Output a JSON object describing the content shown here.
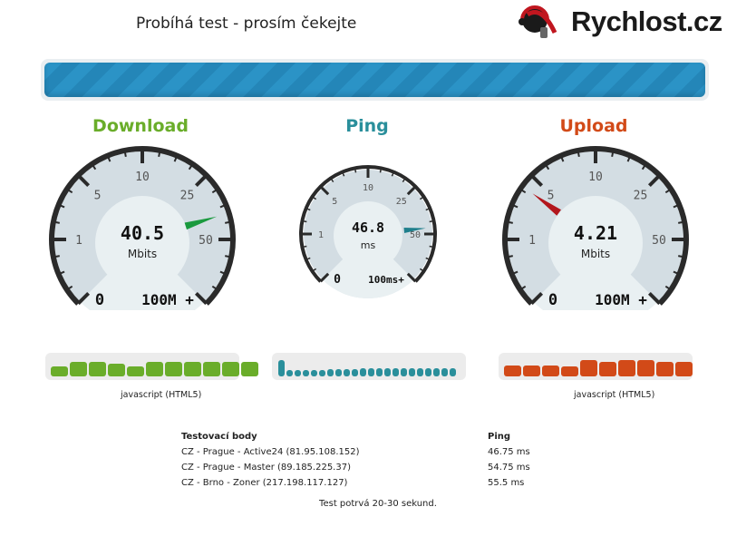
{
  "status_text": "Probíhá test - prosím čekejte",
  "logo_text": "Rychlost.cz",
  "progress_fraction": 1.0,
  "colors": {
    "download": "#6aad2a",
    "ping": "#2a8f9b",
    "upload": "#d24a18",
    "progress": "#2b93c6",
    "needle_download": "#1a9a3e",
    "needle_ping": "#1f7f8c",
    "needle_upload": "#b3161c"
  },
  "download": {
    "title": "Download",
    "value": "40.5",
    "unit": "Mbits",
    "min_label": "0",
    "max_label": "100M +",
    "ticks": [
      "1",
      "5",
      "10",
      "25",
      "50"
    ],
    "needle_value": 40.5,
    "history": [
      0.55,
      0.8,
      0.8,
      0.7,
      0.55,
      0.8,
      0.8,
      0.8,
      0.8,
      0.8,
      0.8
    ],
    "engine": "javascript (HTML5)"
  },
  "ping": {
    "title": "Ping",
    "value": "46.8",
    "unit": "ms",
    "min_label": "0",
    "max_label": "100ms+",
    "ticks": [
      "1",
      "5",
      "10",
      "25",
      "50"
    ],
    "needle_value": 46.8,
    "history": [
      0.9,
      0.35,
      0.35,
      0.35,
      0.35,
      0.35,
      0.4,
      0.4,
      0.4,
      0.4,
      0.45,
      0.45,
      0.45,
      0.45,
      0.45,
      0.45,
      0.45,
      0.45,
      0.45,
      0.45,
      0.45,
      0.45
    ]
  },
  "upload": {
    "title": "Upload",
    "value": "4.21",
    "unit": "Mbits",
    "min_label": "0",
    "max_label": "100M +",
    "ticks": [
      "1",
      "5",
      "10",
      "25",
      "50"
    ],
    "needle_value": 4.21,
    "history": [
      0.6,
      0.6,
      0.6,
      0.55,
      0.9,
      0.8,
      0.9,
      0.9,
      0.8,
      0.8
    ],
    "engine": "javascript (HTML5)"
  },
  "servers": {
    "header_name": "Testovací body",
    "header_ping": "Ping",
    "rows": [
      {
        "name": "CZ - Prague - Active24 (81.95.108.152)",
        "ping": "46.75 ms"
      },
      {
        "name": "CZ - Prague - Master (89.185.225.37)",
        "ping": "54.75 ms"
      },
      {
        "name": "CZ - Brno - Zoner (217.198.117.127)",
        "ping": "55.5 ms"
      }
    ]
  },
  "note": "Test potrvá 20-30 sekund."
}
